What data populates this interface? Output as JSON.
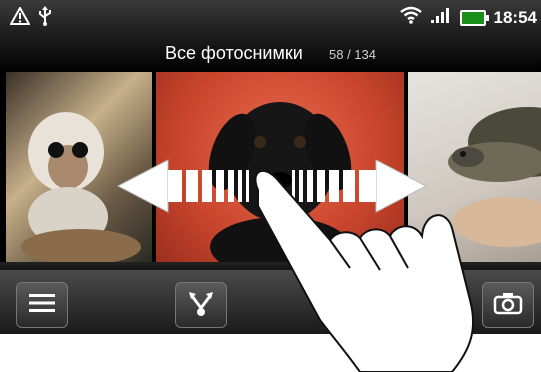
{
  "status_bar": {
    "time": "18:54",
    "icons": [
      "warning-icon",
      "usb-icon",
      "wifi-icon",
      "signal-icon",
      "battery-icon"
    ]
  },
  "album": {
    "title": "Все фотоснимки",
    "counter": "58 / 134"
  },
  "photos": [
    {
      "subject": "monkey"
    },
    {
      "subject": "puppy"
    },
    {
      "subject": "turtle"
    }
  ],
  "bottom_bar": {
    "buttons": [
      "menu-icon",
      "share-icon",
      "camera-icon"
    ]
  },
  "gesture": {
    "type": "swipe-left-right",
    "icons": [
      "double-arrow-icon",
      "hand-icon"
    ]
  }
}
